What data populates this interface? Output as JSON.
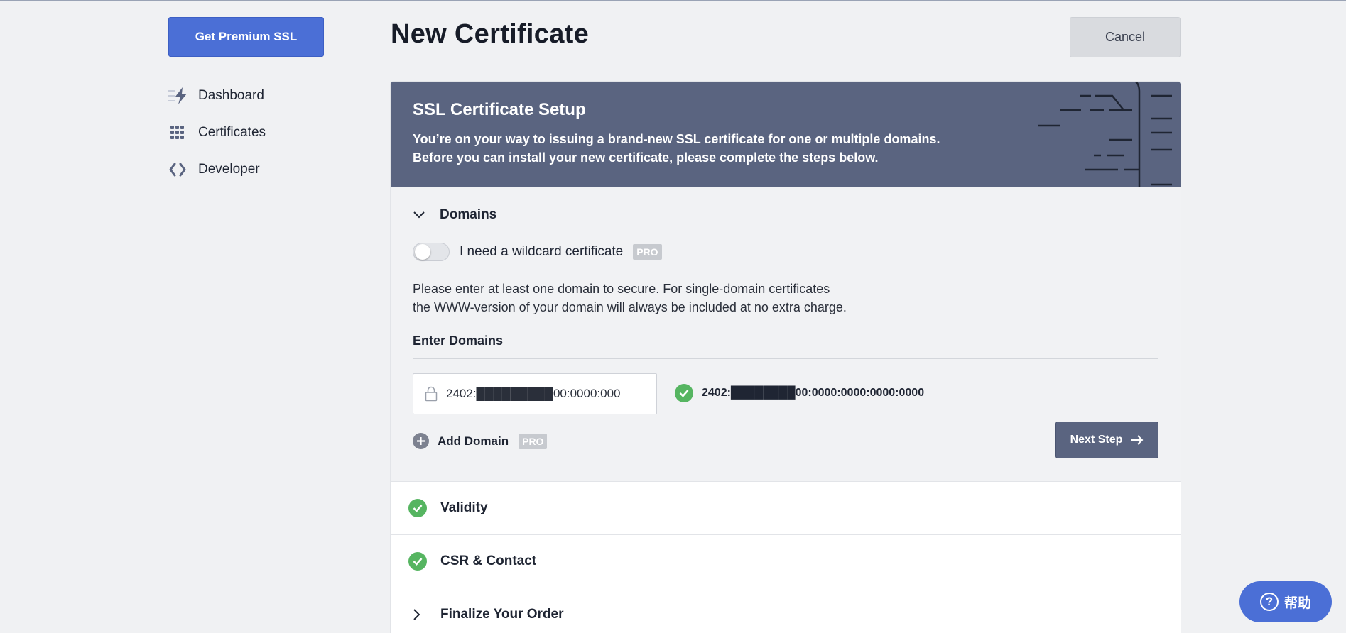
{
  "sidebar": {
    "premium_button": "Get Premium SSL",
    "items": [
      {
        "label": "Dashboard",
        "icon": "bolt-icon"
      },
      {
        "label": "Certificates",
        "icon": "grid-icon"
      },
      {
        "label": "Developer",
        "icon": "code-brackets-icon"
      }
    ]
  },
  "header": {
    "title": "New Certificate",
    "cancel_label": "Cancel"
  },
  "banner": {
    "title": "SSL Certificate Setup",
    "line1": "You’re on your way to issuing a brand-new SSL certificate for one or multiple domains.",
    "line2": "Before you can install your new certificate, please complete the steps below."
  },
  "domains": {
    "section_title": "Domains",
    "wildcard_label": "I need a wildcard certificate",
    "wildcard_enabled": false,
    "pro_badge": "PRO",
    "desc_line1": "Please enter at least one domain to secure. For single-domain certificates",
    "desc_line2": "the WWW-version of your domain will always be included at no extra charge.",
    "enter_label": "Enter Domains",
    "input_value": "2402:█████████00:0000:000",
    "verified_domain": "2402:████████00:0000:0000:0000:0000",
    "add_domain_label": "Add Domain",
    "next_step_label": "Next Step"
  },
  "steps": [
    {
      "label": "Validity",
      "status": "complete"
    },
    {
      "label": "CSR & Contact",
      "status": "complete"
    },
    {
      "label": "Finalize Your Order",
      "status": "collapsed"
    }
  ],
  "help": {
    "label": "帮助"
  },
  "colors": {
    "primary": "#4b6fd6",
    "banner": "#5a6480",
    "success": "#56b561",
    "background": "#f0f1f3"
  }
}
